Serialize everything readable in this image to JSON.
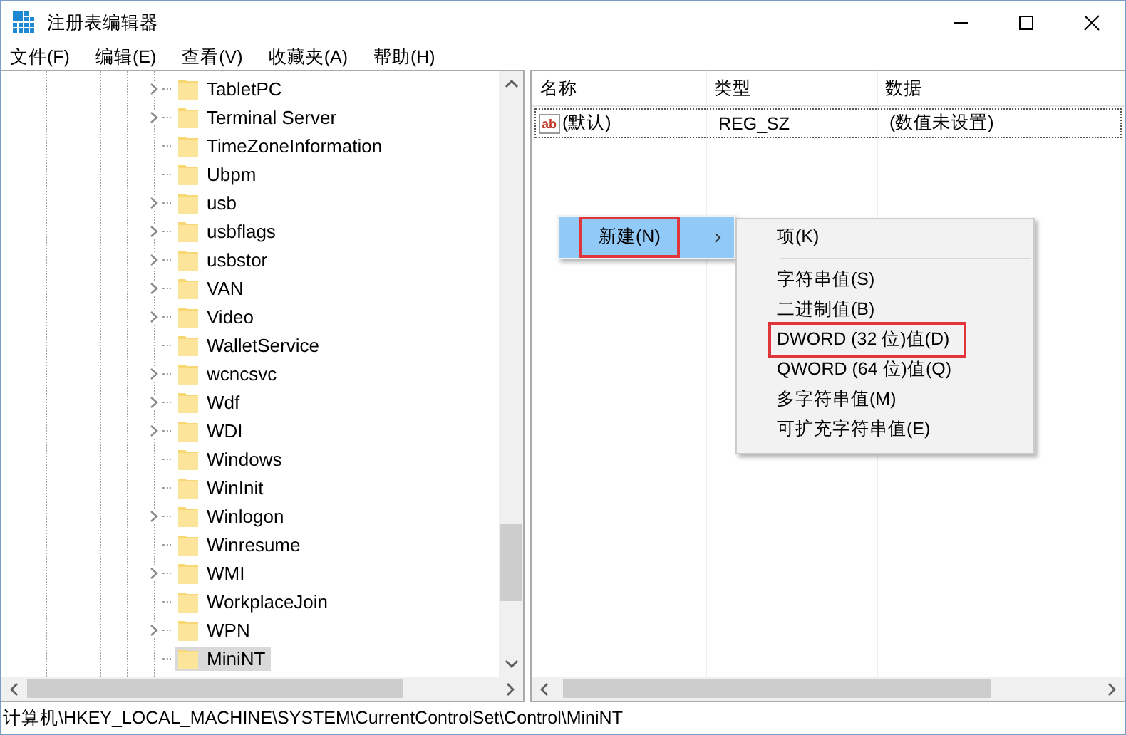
{
  "window": {
    "title": "注册表编辑器"
  },
  "menu_bar": [
    "文件(F)",
    "编辑(E)",
    "查看(V)",
    "收藏夹(A)",
    "帮助(H)"
  ],
  "tree": {
    "items": [
      {
        "label": "TabletPC",
        "has_children": true,
        "selected": false
      },
      {
        "label": "Terminal Server",
        "has_children": true,
        "selected": false
      },
      {
        "label": "TimeZoneInformation",
        "has_children": false,
        "selected": false
      },
      {
        "label": "Ubpm",
        "has_children": false,
        "selected": false
      },
      {
        "label": "usb",
        "has_children": true,
        "selected": false
      },
      {
        "label": "usbflags",
        "has_children": true,
        "selected": false
      },
      {
        "label": "usbstor",
        "has_children": true,
        "selected": false
      },
      {
        "label": "VAN",
        "has_children": true,
        "selected": false
      },
      {
        "label": "Video",
        "has_children": true,
        "selected": false
      },
      {
        "label": "WalletService",
        "has_children": false,
        "selected": false
      },
      {
        "label": "wcncsvc",
        "has_children": true,
        "selected": false
      },
      {
        "label": "Wdf",
        "has_children": true,
        "selected": false
      },
      {
        "label": "WDI",
        "has_children": true,
        "selected": false
      },
      {
        "label": "Windows",
        "has_children": false,
        "selected": false
      },
      {
        "label": "WinInit",
        "has_children": false,
        "selected": false
      },
      {
        "label": "Winlogon",
        "has_children": true,
        "selected": false
      },
      {
        "label": "Winresume",
        "has_children": false,
        "selected": false
      },
      {
        "label": "WMI",
        "has_children": true,
        "selected": false
      },
      {
        "label": "WorkplaceJoin",
        "has_children": false,
        "selected": false
      },
      {
        "label": "WPN",
        "has_children": true,
        "selected": false
      },
      {
        "label": "MiniNT",
        "has_children": false,
        "selected": true
      }
    ]
  },
  "values_table": {
    "columns": [
      "名称",
      "类型",
      "数据"
    ],
    "rows": [
      {
        "icon_text": "ab",
        "name": "(默认)",
        "type": "REG_SZ",
        "data": "(数值未设置)"
      }
    ]
  },
  "context_menu": {
    "items": [
      {
        "label": "新建(N)",
        "selected": true,
        "outlined": true
      }
    ]
  },
  "submenu": {
    "items": [
      {
        "kind": "item",
        "label": "项(K)",
        "outlined": false
      },
      {
        "kind": "separator"
      },
      {
        "kind": "item",
        "label": "字符串值(S)",
        "outlined": false
      },
      {
        "kind": "item",
        "label": "二进制值(B)",
        "outlined": false
      },
      {
        "kind": "item",
        "label": "DWORD (32 位)值(D)",
        "outlined": true
      },
      {
        "kind": "item",
        "label": "QWORD (64 位)值(Q)",
        "outlined": false
      },
      {
        "kind": "item",
        "label": "多字符串值(M)",
        "outlined": false
      },
      {
        "kind": "item",
        "label": "可扩充字符串值(E)",
        "outlined": false
      }
    ]
  },
  "status_bar": "计算机\\HKEY_LOCAL_MACHINE\\SYSTEM\\CurrentControlSet\\Control\\MiniNT"
}
